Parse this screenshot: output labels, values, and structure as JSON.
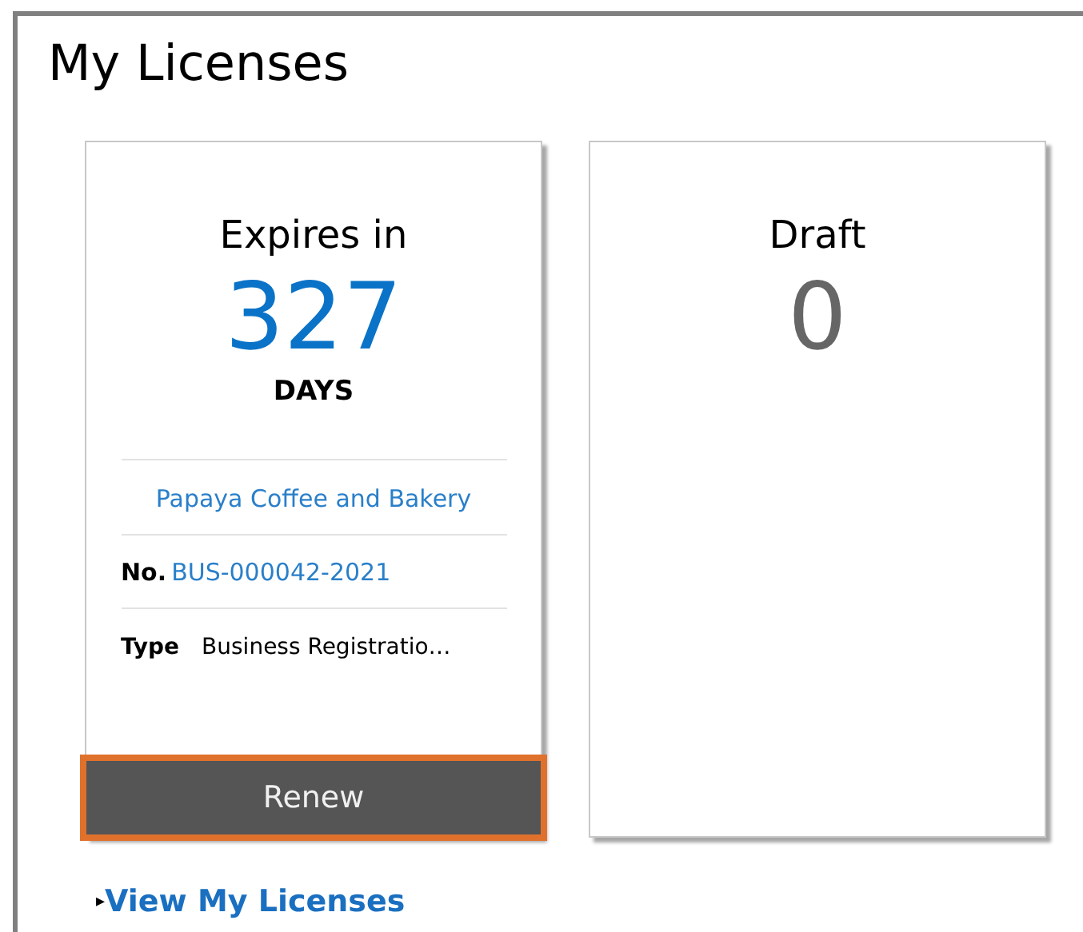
{
  "page": {
    "title": "My Licenses"
  },
  "cards": [
    {
      "kind": "license",
      "heading": "Expires in",
      "count": "327",
      "unit": "DAYS",
      "business_name": "Papaya Coffee and Bakery",
      "number_label": "No.",
      "number": "BUS-000042-2021",
      "type_label": "Type",
      "type": "Business Registratio…",
      "button": {
        "label": "Renew",
        "highlighted": true
      }
    },
    {
      "kind": "draft",
      "heading": "Draft",
      "count": "0"
    }
  ],
  "footer_link": {
    "icon": "▸",
    "label": "View My Licenses"
  }
}
